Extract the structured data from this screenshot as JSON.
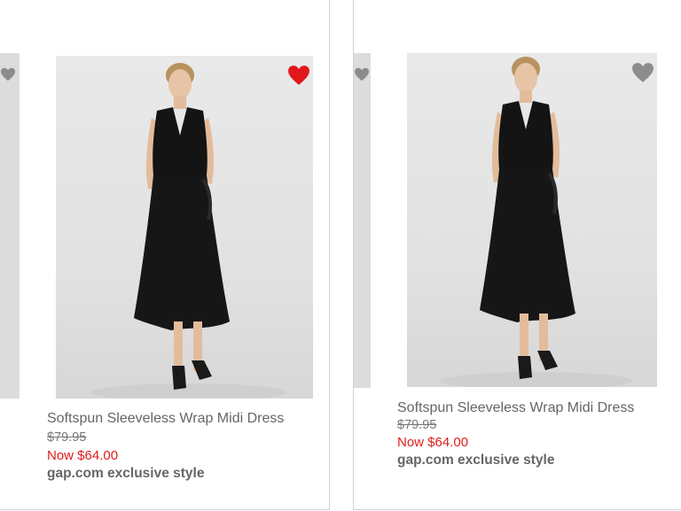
{
  "products": [
    {
      "name": "Softspun Sleeveless Wrap Midi Dress",
      "original_price": "$79.95",
      "sale_price": "Now $64.00",
      "tag": "gap.com exclusive style",
      "favorited": true,
      "heart_color": "#e0181b"
    },
    {
      "name": "Softspun Sleeveless Wrap Midi Dress",
      "original_price": "$79.95",
      "sale_price": "Now $64.00",
      "tag": "gap.com exclusive style",
      "favorited": false,
      "heart_color": "#8c8c8c"
    }
  ],
  "colors": {
    "sale_price": "#e01b1b",
    "text": "#666666",
    "photo_background": "#e6e6e6",
    "dress": "#141414"
  },
  "icons": [
    "heart-icon",
    "heart-outline-icon"
  ]
}
